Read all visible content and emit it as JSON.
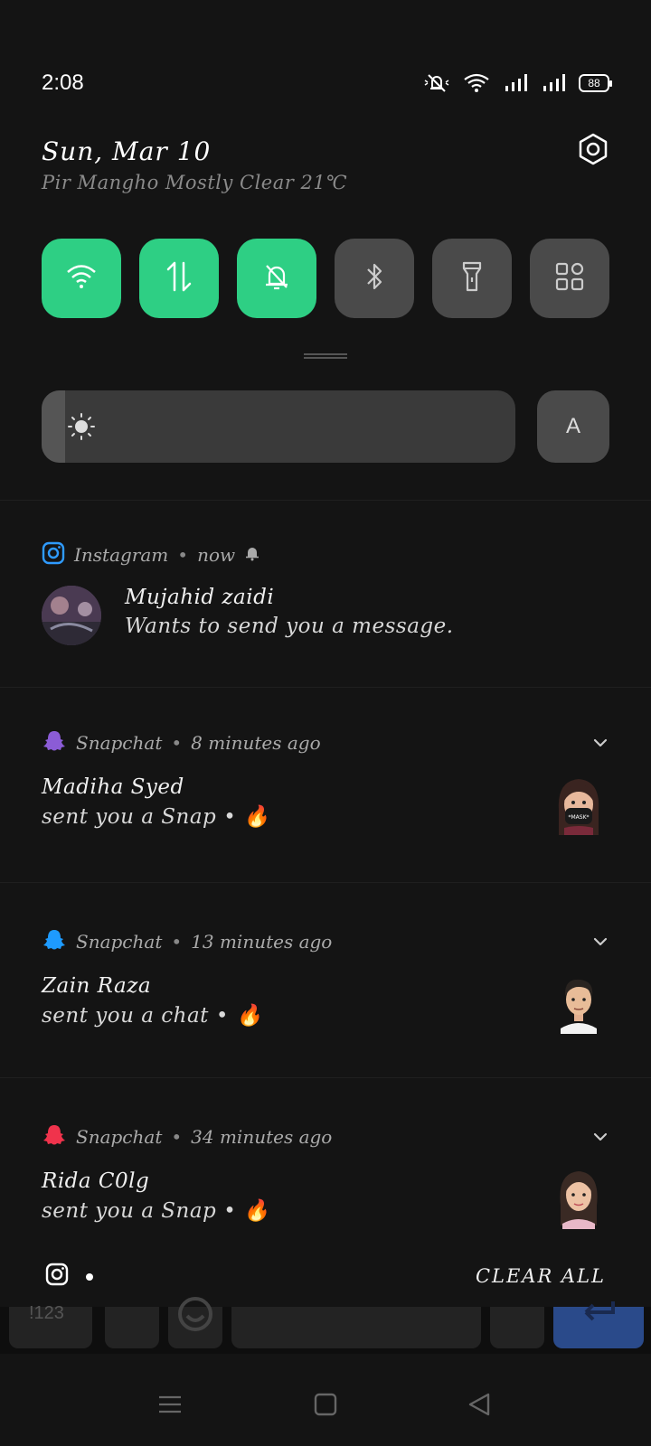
{
  "status_bar": {
    "time": "2:08",
    "battery": "88",
    "icons": [
      "mute-icon",
      "wifi-icon",
      "signal-icon",
      "signal-icon"
    ]
  },
  "header": {
    "date": "Sun, Mar 10",
    "weather": "Pir Mangho Mostly Clear 21℃",
    "settings_icon": "settings-icon"
  },
  "quick_tiles": [
    {
      "name": "wifi",
      "icon": "wifi-icon",
      "state": "on"
    },
    {
      "name": "mobile-data",
      "icon": "data-arrows-icon",
      "state": "on"
    },
    {
      "name": "do-not-disturb",
      "icon": "bell-off-icon",
      "state": "on"
    },
    {
      "name": "bluetooth",
      "icon": "bluetooth-icon",
      "state": "off"
    },
    {
      "name": "flashlight",
      "icon": "flashlight-icon",
      "state": "off"
    },
    {
      "name": "more-tiles",
      "icon": "grid-icon",
      "state": "off"
    }
  ],
  "brightness": {
    "level": 0.05,
    "auto_label": "A"
  },
  "notifications": [
    {
      "app": "Instagram",
      "time": "now",
      "title": "Mujahid zaidi",
      "body": "Wants to send you a message.",
      "app_color": "#2f9bff"
    },
    {
      "app": "Snapchat",
      "time": "8 minutes ago",
      "title": "Madiha Syed",
      "body": "sent you a Snap",
      "emoji": "🔥",
      "app_color": "#8b5cd6"
    },
    {
      "app": "Snapchat",
      "time": "13 minutes ago",
      "title": "Zain Raza",
      "body": "sent you a chat",
      "emoji": "🔥",
      "app_color": "#1e9bff"
    },
    {
      "app": "Snapchat",
      "time": "34 minutes ago",
      "title": "Rida C0lg",
      "body": "sent you a Snap",
      "emoji": "🔥",
      "app_color": "#f0334c"
    }
  ],
  "separator": "•",
  "footer": {
    "clear_all": "CLEAR ALL"
  },
  "keyboard_peek": {
    "key_123": "!123"
  },
  "colors": {
    "background": "#141414",
    "tile_on": "#2ecf84",
    "tile_off": "#4a4a4a"
  }
}
